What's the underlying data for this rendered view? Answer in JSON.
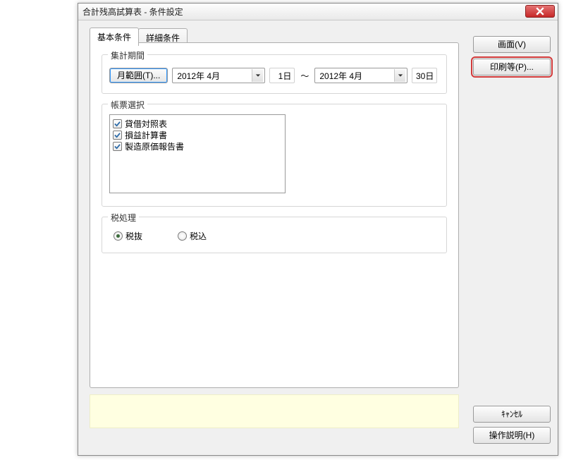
{
  "window": {
    "title": "合計残高試算表 - 条件設定"
  },
  "tabs": {
    "basic": "基本条件",
    "detail": "詳細条件"
  },
  "period": {
    "legend": "集計期間",
    "range_button": "月範囲(T)...",
    "from_month": "2012年  4月",
    "from_day": "1日",
    "separator": "～",
    "to_month": "2012年  4月",
    "to_day": "30日"
  },
  "report": {
    "legend": "帳票選択",
    "items": [
      {
        "label": "貸借対照表",
        "checked": true
      },
      {
        "label": "損益計算書",
        "checked": true
      },
      {
        "label": "製造原価報告書",
        "checked": true
      }
    ]
  },
  "tax": {
    "legend": "税処理",
    "options": [
      "税抜",
      "税込"
    ],
    "selected": 0
  },
  "buttons": {
    "screen": "画面(V)",
    "print": "印刷等(P)...",
    "cancel": "ｷｬﾝｾﾙ",
    "help": "操作説明(H)"
  }
}
